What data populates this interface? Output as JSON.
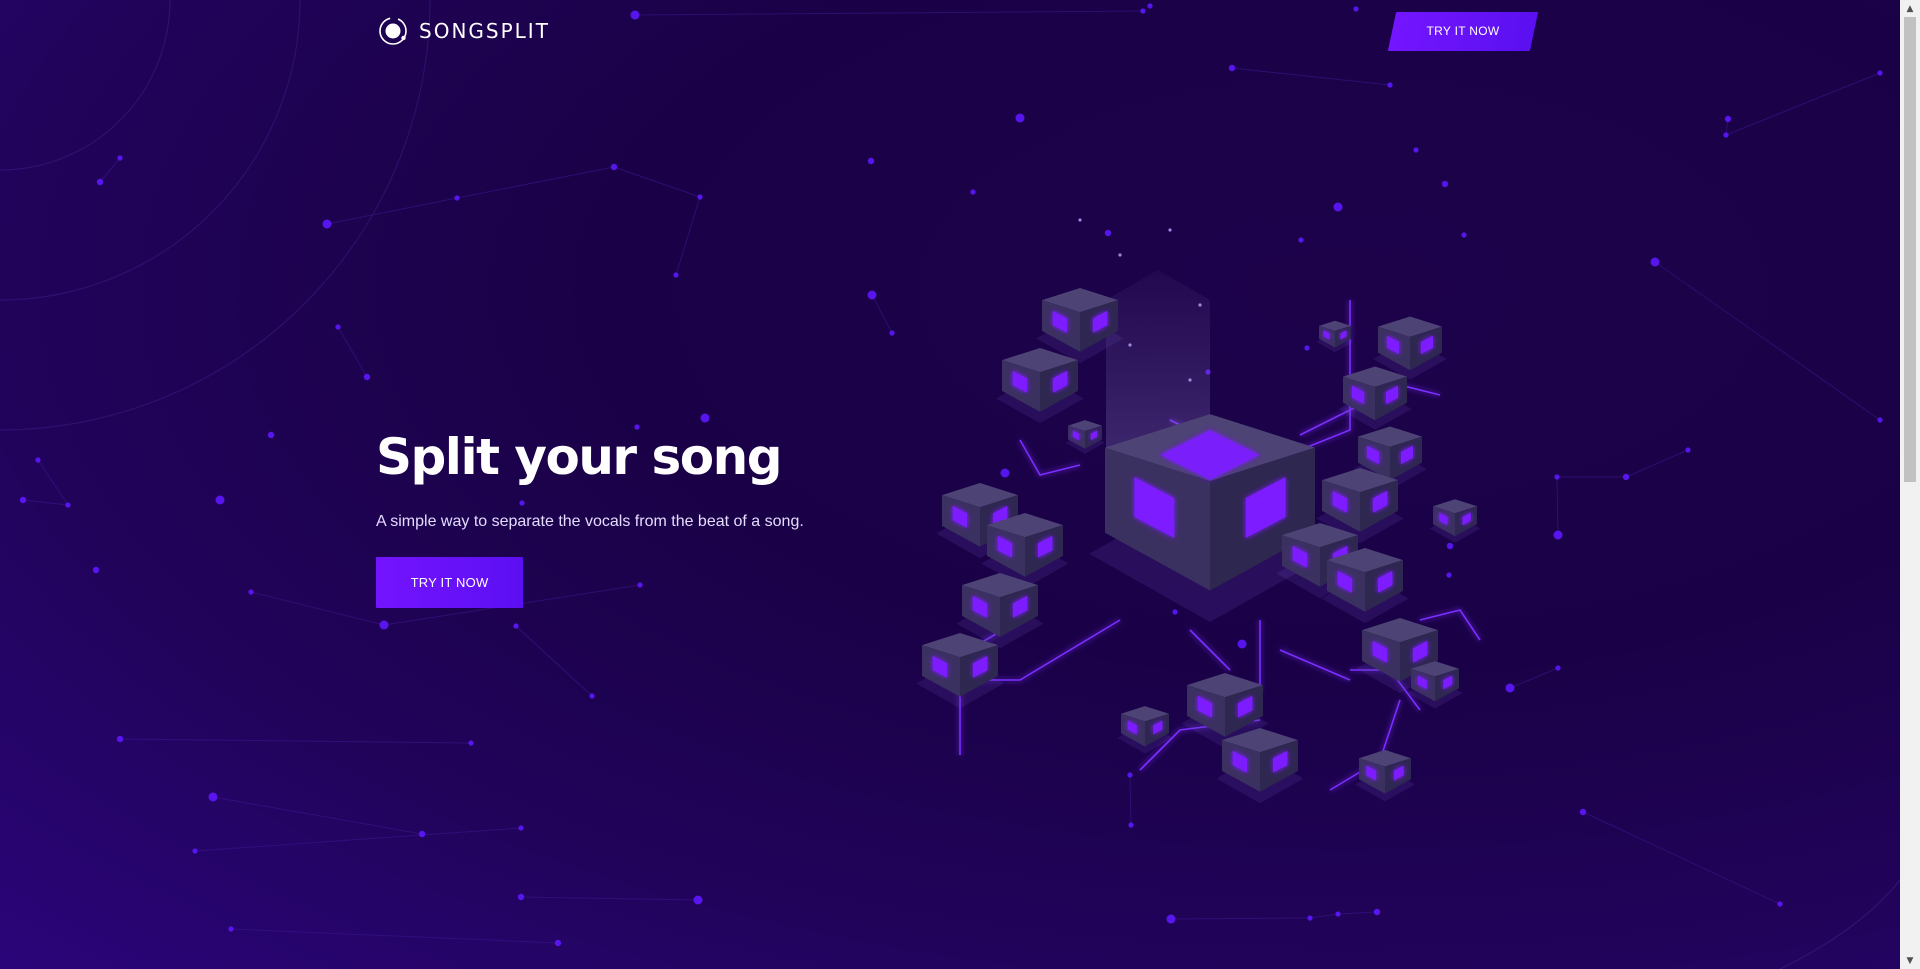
{
  "brand": {
    "name": "SONGSPLIT",
    "logo_icon": "orbit-circle-icon"
  },
  "header": {
    "cta_label": "TRY IT NOW"
  },
  "hero": {
    "title": "Split your song",
    "subtitle": "A simple way to separate the vocals from the beat of a song.",
    "cta_label": "TRY IT NOW"
  },
  "illustration": {
    "icon": "isometric-cubes-network-illustration"
  },
  "colors": {
    "background_dark": "#1a0147",
    "background_light": "#2a057a",
    "accent": "#7415ff",
    "accent_glow": "#8a2bff",
    "dot": "#5e17ff",
    "cube_top": "#4d4375",
    "cube_left": "#3b3160",
    "cube_right": "#2e2750",
    "white": "#ffffff"
  }
}
